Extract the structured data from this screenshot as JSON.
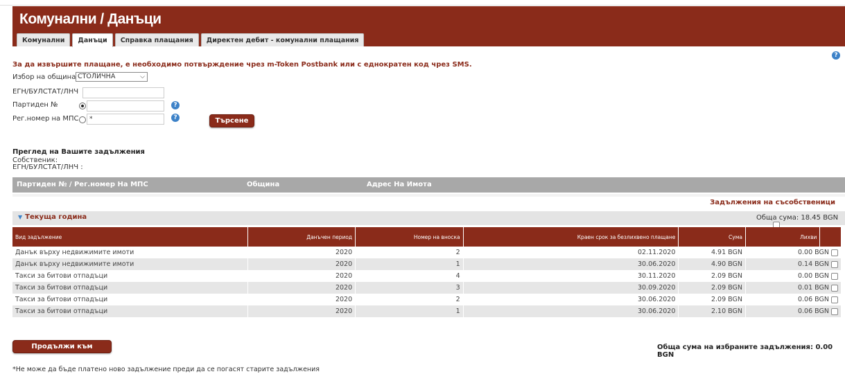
{
  "header": {
    "title": "Комунални / Данъци"
  },
  "tabs": [
    {
      "label": "Комунални",
      "active": false
    },
    {
      "label": "Данъци",
      "active": true
    },
    {
      "label": "Справка плащания",
      "active": false
    },
    {
      "label": "Директен дебит - комунални плащания",
      "active": false
    }
  ],
  "notice": "За да извършите плащане, е необходимо потвърждение чрез m-Token Postbank или с еднократен код чрез SMS.",
  "form": {
    "municipality_label": "Избор на община",
    "municipality_value": "СТОЛИЧНА",
    "egn_label": "ЕГН/БУЛСТАТ/ЛНЧ",
    "egn_value": "",
    "partida_label": "Партиден №",
    "partida_value": "",
    "regnum_label": "Рег.номер на МПС",
    "regnum_value": "*",
    "search_button": "Търсене"
  },
  "review": {
    "title": "Преглед на Вашите задължения",
    "owner_label": "Собственик:",
    "egn_label": "ЕГН/БУЛСТАТ/ЛНЧ :"
  },
  "summary_header": {
    "col1": "Партиден № / Рег.номер На МПС",
    "col2": "Община",
    "col3": "Адрес На Имота"
  },
  "coowners_link": "Задължения на съсобственици",
  "section": {
    "title": "Текуща година",
    "total": "Обща сума: 18.45 BGN"
  },
  "table": {
    "headers": [
      "Вид задължение",
      "Данъчен период",
      "Номер на вноска",
      "Краен срок за безлихвено плащане",
      "Сума",
      "Лихви"
    ],
    "rows": [
      {
        "type": "Данък върху недвижимите имоти",
        "period": "2020",
        "installment": "2",
        "deadline": "02.11.2020",
        "amount": "4.91 BGN",
        "interest": "0.00 BGN"
      },
      {
        "type": "Данък върху недвижимите имоти",
        "period": "2020",
        "installment": "1",
        "deadline": "30.06.2020",
        "amount": "4.90 BGN",
        "interest": "0.14 BGN"
      },
      {
        "type": "Такси за битови отпадъци",
        "period": "2020",
        "installment": "4",
        "deadline": "30.11.2020",
        "amount": "2.09 BGN",
        "interest": "0.00 BGN"
      },
      {
        "type": "Такси за битови отпадъци",
        "period": "2020",
        "installment": "3",
        "deadline": "30.09.2020",
        "amount": "2.09 BGN",
        "interest": "0.01 BGN"
      },
      {
        "type": "Такси за битови отпадъци",
        "period": "2020",
        "installment": "2",
        "deadline": "30.06.2020",
        "amount": "2.09 BGN",
        "interest": "0.06 BGN"
      },
      {
        "type": "Такси за битови отпадъци",
        "period": "2020",
        "installment": "1",
        "deadline": "30.06.2020",
        "amount": "2.10 BGN",
        "interest": "0.06 BGN"
      }
    ]
  },
  "continue_button": "Продължи към плащане",
  "selected_total": "Обща сума на избраните задължения: 0.00 BGN",
  "footnote": "*Не може да бъде платено ново задължение преди да се погасят старите задължения",
  "colors": {
    "brand": "#8a2b1a",
    "help": "#3d82c8",
    "header_gray": "#a8a8a8"
  },
  "icons": {
    "help": "question-circle-icon",
    "collapse": "triangle-down-icon",
    "dropdown": "chevron-down-icon"
  }
}
